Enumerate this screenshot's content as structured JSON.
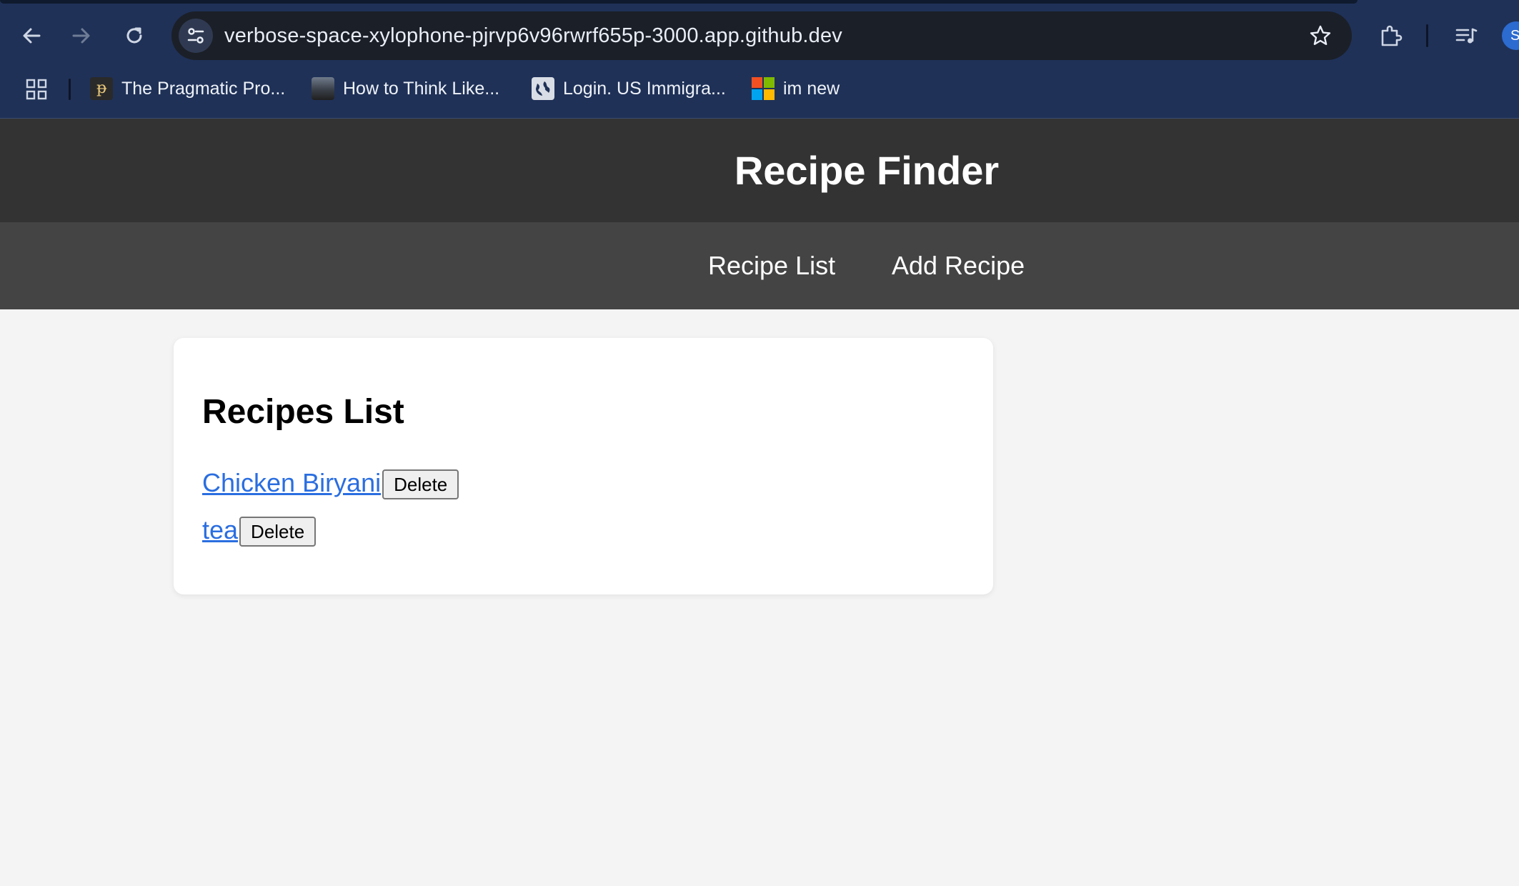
{
  "browser": {
    "url": "verbose-space-xylophone-pjrvp6v96rwrf655p-3000.app.github.dev",
    "profile_initial": "S",
    "bookmarks": [
      {
        "label": "The Pragmatic Pro...",
        "icon": "pragmatic-favicon"
      },
      {
        "label": "How to Think Like...",
        "icon": "think-favicon"
      },
      {
        "label": "Login. US Immigra...",
        "icon": "globe-icon"
      },
      {
        "label": "im new",
        "icon": "microsoft-favicon"
      }
    ],
    "colors": {
      "frame": "#1f3157",
      "omnibox": "#1b1f27"
    }
  },
  "header": {
    "title": "Recipe Finder"
  },
  "nav": {
    "links": [
      {
        "label": "Recipe List"
      },
      {
        "label": "Add Recipe"
      }
    ]
  },
  "main": {
    "heading": "Recipes List",
    "recipes": [
      {
        "name": "Chicken Biryani",
        "delete_label": "Delete"
      },
      {
        "name": "tea",
        "delete_label": "Delete"
      }
    ]
  },
  "colors": {
    "header_bg": "#333333",
    "nav_bg": "#444444",
    "page_bg": "#f4f4f4",
    "link": "#2a6ee0"
  }
}
